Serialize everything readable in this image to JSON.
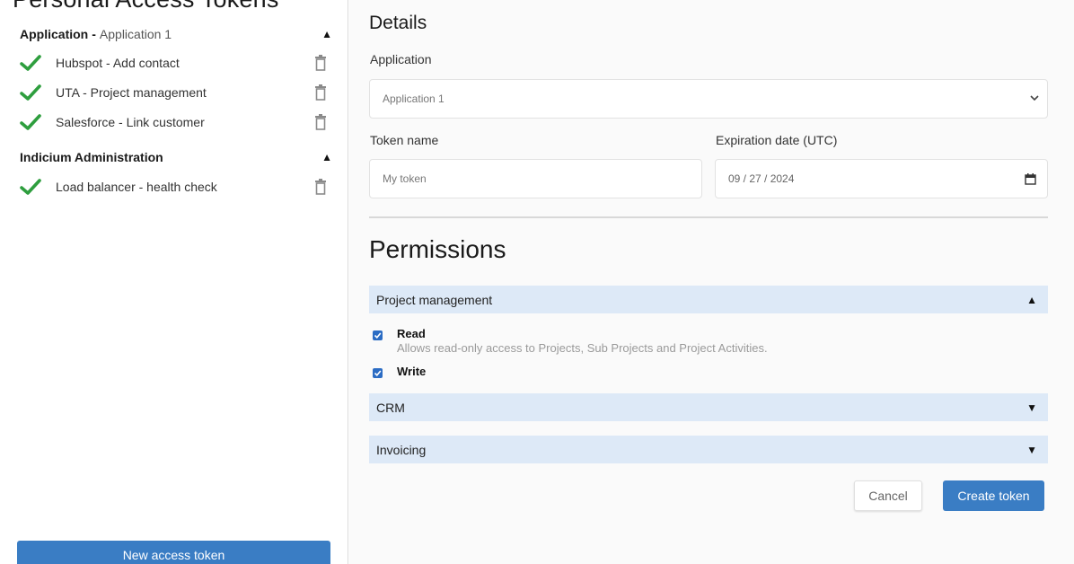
{
  "sidebar": {
    "title": "Personal Access Tokens",
    "groups": [
      {
        "name": "Application",
        "separator": "-",
        "subtitle": "Application 1",
        "caret_icon": "caret-up-icon",
        "tokens": [
          {
            "label": "Hubspot - Add contact",
            "status_icon": "check-icon",
            "action_icon": "trash-icon"
          },
          {
            "label": "UTA - Project management",
            "status_icon": "check-icon",
            "action_icon": "trash-icon"
          },
          {
            "label": "Salesforce - Link customer",
            "status_icon": "check-icon",
            "action_icon": "trash-icon"
          }
        ]
      },
      {
        "name": "Indicium Administration",
        "caret_icon": "caret-up-icon",
        "tokens": [
          {
            "label": "Load balancer - health check",
            "status_icon": "check-icon",
            "action_icon": "trash-icon"
          }
        ]
      }
    ],
    "new_token_button": "New access token"
  },
  "details": {
    "title": "Details",
    "application": {
      "label": "Application",
      "value": "Application 1"
    },
    "token_name": {
      "label": "Token name",
      "placeholder": "My token"
    },
    "expiration": {
      "label": "Expiration date (UTC)",
      "value": "09 / 27 / 2024"
    }
  },
  "permissions": {
    "title": "Permissions",
    "sections": [
      {
        "name": "Project management",
        "expanded": true,
        "caret_icon": "caret-up-icon",
        "items": [
          {
            "name": "Read",
            "description": "Allows read-only access to Projects, Sub Projects and Project Activities.",
            "checked": true
          },
          {
            "name": "Write",
            "checked": true
          }
        ]
      },
      {
        "name": "CRM",
        "expanded": false,
        "caret_icon": "caret-down-icon"
      },
      {
        "name": "Invoicing",
        "expanded": false,
        "caret_icon": "caret-down-icon"
      }
    ]
  },
  "actions": {
    "cancel": "Cancel",
    "create": "Create token"
  },
  "colors": {
    "accent": "#3a7dc4",
    "check_green": "#2e9e3e",
    "section_background": "#dde9f7",
    "checkbox_blue": "#2b6cc4"
  }
}
